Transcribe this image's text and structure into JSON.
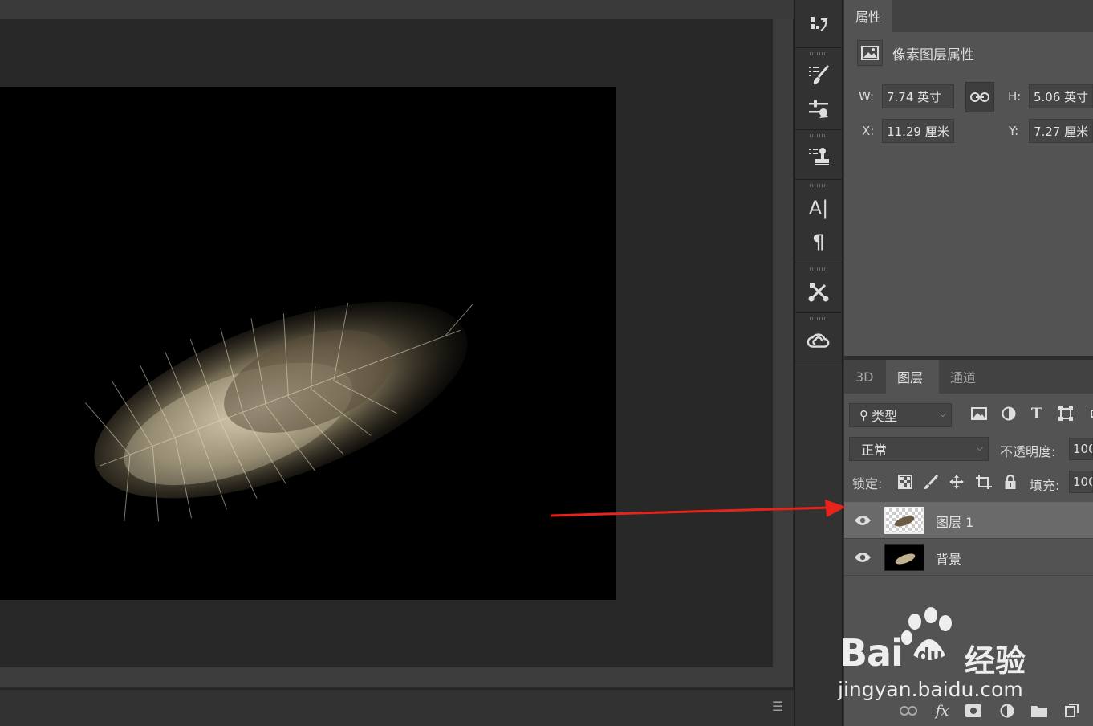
{
  "properties_panel": {
    "tab_label": "属性",
    "header_label": "像素图层属性",
    "w_label": "W:",
    "w_value": "7.74 英寸",
    "h_label": "H:",
    "h_value": "5.06 英寸",
    "x_label": "X:",
    "x_value": "11.29 厘米",
    "y_label": "Y:",
    "y_value": "7.27 厘米"
  },
  "layers_panel": {
    "tabs": [
      {
        "label": "3D",
        "active": false
      },
      {
        "label": "图层",
        "active": true
      },
      {
        "label": "通道",
        "active": false
      }
    ],
    "filter_label": "类型",
    "blend_mode": "正常",
    "opacity_label": "不透明度:",
    "opacity_value": "100",
    "lock_label": "锁定:",
    "fill_label": "填充:",
    "fill_value": "100",
    "layers": [
      {
        "name": "图层 1",
        "selected": true,
        "visible": true
      },
      {
        "name": "背景",
        "selected": false,
        "visible": true
      }
    ],
    "footer_fx": "fx"
  },
  "icon_strip": {
    "icons": [
      "history-icon",
      "brush-settings-icon",
      "adjustments-icon",
      "clone-source-icon",
      "character-icon",
      "paragraph-icon",
      "tool-presets-icon",
      "creative-cloud-icon"
    ]
  },
  "watermark": {
    "brand_left": "Bai",
    "brand_right": "经验",
    "url": "jingyan.baidu.com"
  },
  "colors": {
    "panel_bg": "#535353",
    "workspace_bg": "#282828",
    "selected_layer": "#6a6a6a",
    "arrow": "#e8231c"
  }
}
